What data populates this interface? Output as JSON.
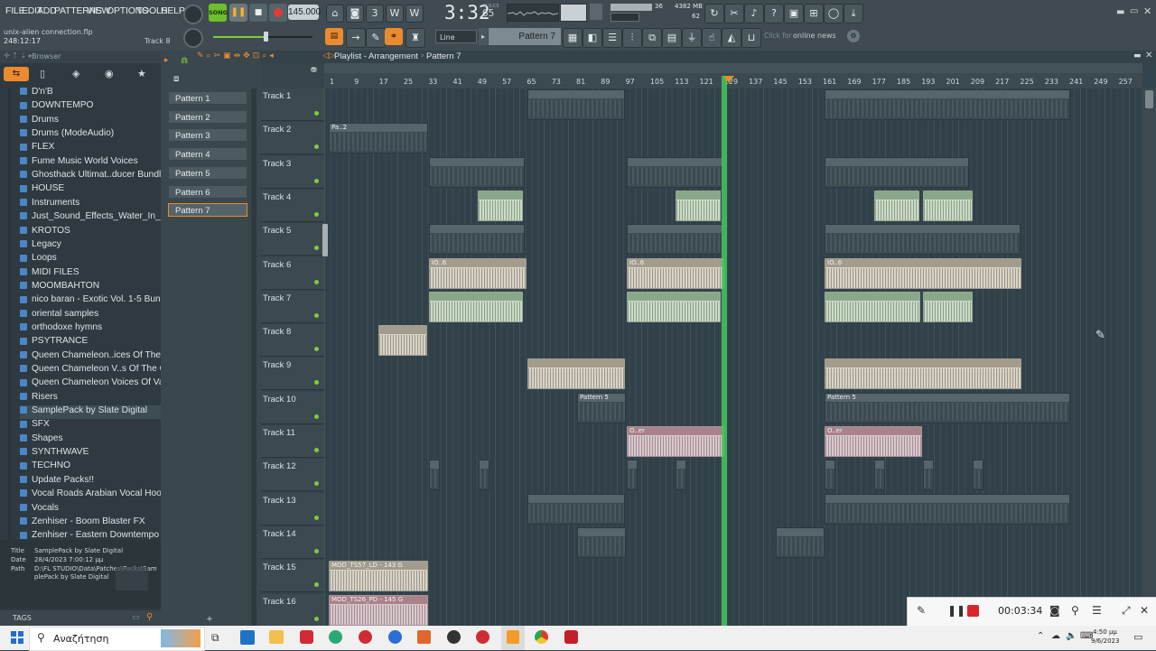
{
  "menu": [
    "FILE",
    "EDIT",
    "ADD",
    "PATTERNS",
    "VIEW",
    "OPTIONS",
    "TOOLS",
    "HELP"
  ],
  "transport": {
    "mode": "SONG",
    "tempo": "145.000",
    "time": "3:32",
    "time_sub": "65",
    "time_label": "M:S:CS"
  },
  "cpu": {
    "value": "36",
    "memory": "4382 MB",
    "voices": "62"
  },
  "project": {
    "name": "unix-alien connection.flp",
    "position": "248:12:17",
    "track": "Track 8"
  },
  "toolbar2": {
    "snap": "Line",
    "pattern": "Pattern 7",
    "news_hint": "Click for",
    "news": "online news"
  },
  "browser": {
    "title": "Browser",
    "items": [
      "D'n'B",
      "DOWNTEMPO",
      "Drums",
      "Drums (ModeAudio)",
      "FLEX",
      "Fume Music World Voices",
      "Ghosthack Ultimat..ducer Bundle 2022",
      "HOUSE",
      "Instruments",
      "Just_Sound_Effects_Water_In_Motion",
      "KROTOS",
      "Legacy",
      "Loops",
      "MIDI FILES",
      "MOOMBAHTON",
      "nico baran - Exotic Vol. 1-5 Bundle",
      "oriental samples",
      "orthodoxe hymns",
      "PSYTRANCE",
      "Queen Chameleon..ices Of The Opera",
      "Queen Chameleon V..s Of The Opera II",
      "Queen Chameleon Voices Of Valhalla",
      "Risers",
      "SamplePack by Slate Digital",
      "SFX",
      "Shapes",
      "SYNTHWAVE",
      "TECHNO",
      "Update Packs!!",
      "Vocal Roads Arabian Vocal Hooks",
      "Vocals",
      "Zenhiser - Boom Blaster FX",
      "Zenhiser - Eastern Downtempo"
    ],
    "selected_index": 23,
    "info": {
      "title_label": "Title",
      "title": "SamplePack by Slate Digital",
      "date_label": "Date",
      "date": "28/4/2023 7:00:12 μμ",
      "path_label": "Path",
      "path": "D:\\FL STUDIO\\Data\\Patches\\Packs\\SamplePack by Slate Digital"
    },
    "tags": "TAGS"
  },
  "patterns": [
    "Pattern 1",
    "Pattern 2",
    "Pattern 3",
    "Pattern 4",
    "Pattern 5",
    "Pattern 6",
    "Pattern 7"
  ],
  "playlist": {
    "title": "Playlist - Arrangement",
    "pattern": "Pattern 7"
  },
  "ruler": [
    "1",
    "9",
    "17",
    "25",
    "33",
    "41",
    "49",
    "57",
    "65",
    "73",
    "81",
    "89",
    "97",
    "105",
    "113",
    "121",
    "129",
    "137",
    "145",
    "153",
    "161",
    "169",
    "177",
    "185",
    "193",
    "201",
    "209",
    "217",
    "225",
    "233",
    "241",
    "249",
    "257"
  ],
  "tracks": [
    "Track 1",
    "Track 2",
    "Track 3",
    "Track 4",
    "Track 5",
    "Track 6",
    "Track 7",
    "Track 8",
    "Track 9",
    "Track 10",
    "Track 11",
    "Track 12",
    "Track 13",
    "Track 14",
    "Track 15",
    "Track 16"
  ],
  "clip_labels": {
    "pa2": "Pa..2",
    "io6": "IO..6",
    "p5": "Pattern 5",
    "oer": "O..er",
    "mod15": "MOD_TS57_LD - 143 G",
    "mod16": "MOD_TS26_PD - 145 G"
  },
  "recorder": {
    "time": "00:03:34"
  },
  "taskbar": {
    "search": "Αναζήτηση",
    "clock": "4:50 μμ",
    "date": "9/6/2023"
  },
  "colors": {
    "accent_green": "#7ecb3f",
    "playhead": "#42c95a",
    "orange": "#e98b2e"
  }
}
